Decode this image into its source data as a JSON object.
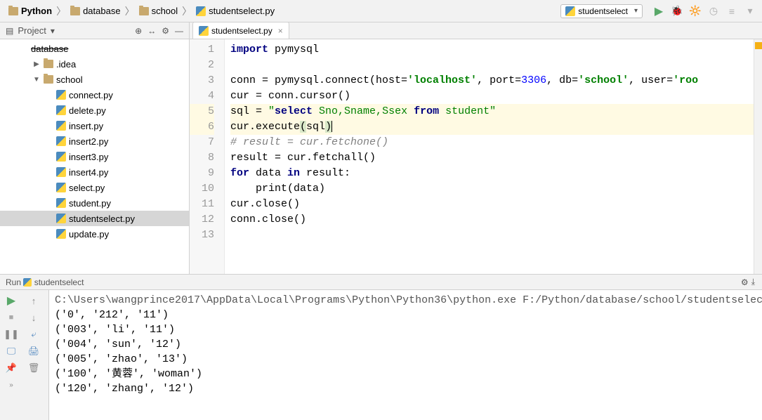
{
  "breadcrumb": [
    {
      "label": "Python",
      "icon": "folder",
      "bold": true
    },
    {
      "label": "database",
      "icon": "folder"
    },
    {
      "label": "school",
      "icon": "folder"
    },
    {
      "label": "studentselect.py",
      "icon": "python"
    }
  ],
  "run_config": "studentselect",
  "project_header": {
    "label": "Project"
  },
  "tree": [
    {
      "label": "database",
      "depth": 1,
      "arrow": "",
      "icon": "none",
      "strike": true
    },
    {
      "label": ".idea",
      "depth": 2,
      "arrow": "▶",
      "icon": "folder"
    },
    {
      "label": "school",
      "depth": 2,
      "arrow": "▼",
      "icon": "folder"
    },
    {
      "label": "connect.py",
      "depth": 3,
      "arrow": "",
      "icon": "python"
    },
    {
      "label": "delete.py",
      "depth": 3,
      "arrow": "",
      "icon": "python"
    },
    {
      "label": "insert.py",
      "depth": 3,
      "arrow": "",
      "icon": "python"
    },
    {
      "label": "insert2.py",
      "depth": 3,
      "arrow": "",
      "icon": "python"
    },
    {
      "label": "insert3.py",
      "depth": 3,
      "arrow": "",
      "icon": "python"
    },
    {
      "label": "insert4.py",
      "depth": 3,
      "arrow": "",
      "icon": "python"
    },
    {
      "label": "select.py",
      "depth": 3,
      "arrow": "",
      "icon": "python"
    },
    {
      "label": "student.py",
      "depth": 3,
      "arrow": "",
      "icon": "python"
    },
    {
      "label": "studentselect.py",
      "depth": 3,
      "arrow": "",
      "icon": "python",
      "selected": true
    },
    {
      "label": "update.py",
      "depth": 3,
      "arrow": "",
      "icon": "python"
    }
  ],
  "tabs": [
    {
      "label": "studentselect.py"
    }
  ],
  "code_lines": [
    {
      "n": 1,
      "tokens": [
        [
          "kw",
          "import"
        ],
        [
          "",
          " pymysql"
        ]
      ]
    },
    {
      "n": 2,
      "tokens": []
    },
    {
      "n": 3,
      "tokens": [
        [
          "",
          "conn = pymysql.connect(host="
        ],
        [
          "str",
          "'localhost'"
        ],
        [
          "",
          ", port="
        ],
        [
          "num",
          "3306"
        ],
        [
          "",
          ", db="
        ],
        [
          "str",
          "'school'"
        ],
        [
          "",
          ", user="
        ],
        [
          "str",
          "'roo"
        ]
      ]
    },
    {
      "n": 4,
      "tokens": [
        [
          "",
          "cur = conn.cursor()"
        ]
      ]
    },
    {
      "n": 5,
      "hl": true,
      "tokens": [
        [
          "",
          "sql = "
        ],
        [
          "str2",
          "\""
        ],
        [
          "kw",
          "select"
        ],
        [
          "str2",
          " Sno,Sname,Ssex "
        ],
        [
          "kw",
          "from"
        ],
        [
          "str2",
          " student\""
        ]
      ]
    },
    {
      "n": 6,
      "hl": true,
      "tokens": [
        [
          "",
          "cur.execute"
        ],
        [
          "par-hl",
          "("
        ],
        [
          "",
          "sql"
        ],
        [
          "par-hl",
          ")"
        ],
        [
          "cursor",
          ""
        ]
      ]
    },
    {
      "n": 7,
      "tokens": [
        [
          "cmt",
          "# result = cur.fetchone()"
        ]
      ]
    },
    {
      "n": 8,
      "tokens": [
        [
          "",
          "result = cur.fetchall()"
        ]
      ]
    },
    {
      "n": 9,
      "tokens": [
        [
          "kw",
          "for"
        ],
        [
          "",
          " data "
        ],
        [
          "kw",
          "in"
        ],
        [
          "",
          " result:"
        ]
      ]
    },
    {
      "n": 10,
      "tokens": [
        [
          "",
          "    "
        ],
        [
          "fn",
          "print"
        ],
        [
          "",
          "(data)"
        ]
      ]
    },
    {
      "n": 11,
      "tokens": [
        [
          "",
          "cur.close()"
        ]
      ]
    },
    {
      "n": 12,
      "tokens": [
        [
          "",
          "conn.close()"
        ]
      ]
    },
    {
      "n": 13,
      "tokens": []
    }
  ],
  "run_tab": {
    "prefix": "Run",
    "name": "studentselect"
  },
  "console_lines": [
    "C:\\Users\\wangprince2017\\AppData\\Local\\Programs\\Python\\Python36\\python.exe F:/Python/database/school/studentselect.py",
    "('0', '212', '11')",
    "('003', 'li', '11')",
    "('004', 'sun', '12')",
    "('005', 'zhao', '13')",
    "('100', '黄蓉', 'woman')",
    "('120', 'zhang', '12')"
  ],
  "icons": {
    "run": "▶",
    "debug": "🐞",
    "coverage": "🔆",
    "more1": "◷",
    "more2": "≡",
    "more3": "▾",
    "gear": "⚙",
    "collapse": "⤓",
    "pin": "📌",
    "trash": "🗑",
    "arrow_up": "↑",
    "arrow_down": "↓",
    "stop": "■",
    "pause": "❚❚",
    "target": "⊕",
    "hide": "—",
    "expand": "↔"
  }
}
